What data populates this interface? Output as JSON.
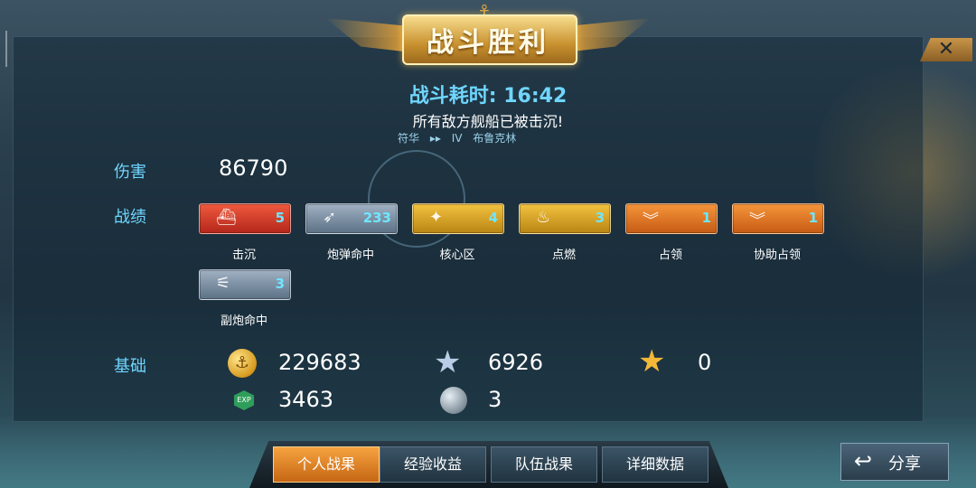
{
  "header": {
    "title": "战斗胜利",
    "close_symbol": "✕"
  },
  "battle": {
    "duration_label": "战斗耗时:",
    "duration": "16:42",
    "result_text": "所有敌方舰船已被击沉!",
    "player_name": "符华",
    "ship_tier": "IV",
    "ship_name": "布鲁克林"
  },
  "sections": {
    "damage_label": "伤害",
    "achievements_label": "战绩",
    "base_label": "基础"
  },
  "damage": "86790",
  "achievements": [
    {
      "icon": "sinking-ship-icon",
      "count": "5",
      "caption": "击沉",
      "color": "#d63a25"
    },
    {
      "icon": "shell-hit-icon",
      "count": "233",
      "caption": "炮弹命中",
      "color": "#7e91a5"
    },
    {
      "icon": "citadel-icon",
      "count": "4",
      "caption": "核心区",
      "color": "#d9a22a"
    },
    {
      "icon": "fire-icon",
      "count": "3",
      "caption": "点燃",
      "color": "#d9a22a"
    },
    {
      "icon": "capture-icon",
      "count": "1",
      "caption": "占领",
      "color": "#e07a25"
    },
    {
      "icon": "assist-capture-icon",
      "count": "1",
      "caption": "协助占领",
      "color": "#e07a25"
    },
    {
      "icon": "secondary-gun-icon",
      "count": "3",
      "caption": "副炮命中",
      "color": "#7e91a5"
    }
  ],
  "base_stats": {
    "credits": "229683",
    "exp": "3463",
    "free_exp": "6926",
    "commander_exp": "0",
    "orb_count": "3",
    "exp_badge": "EXP"
  },
  "tabs": [
    {
      "label": "个人战果",
      "active": true
    },
    {
      "label": "经验收益",
      "active": false
    },
    {
      "label": "队伍战果",
      "active": false
    },
    {
      "label": "详细数据",
      "active": false
    }
  ],
  "share": {
    "label": "分享"
  }
}
